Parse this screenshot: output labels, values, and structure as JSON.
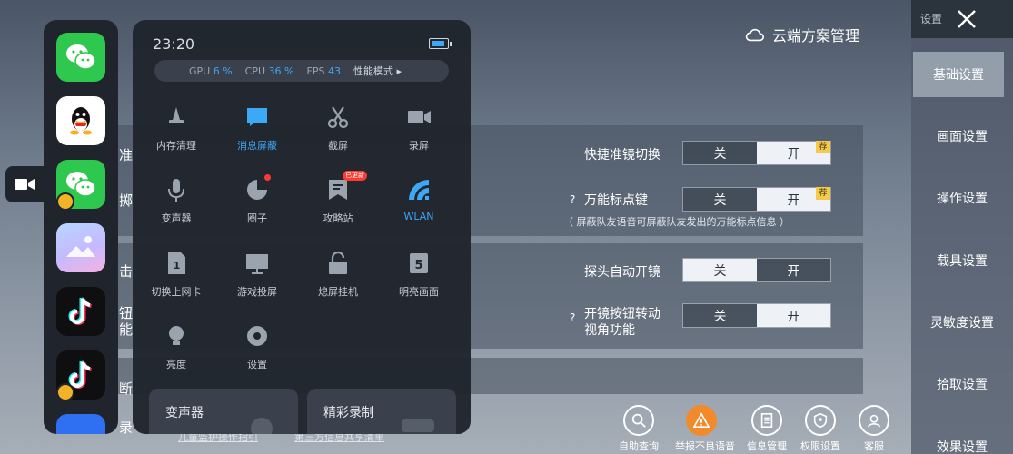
{
  "game": {
    "cloud_title": "云端方案管理",
    "rows": [
      {
        "label": "快捷准镜切换",
        "off": "关",
        "on": "开",
        "state": "on",
        "badge": "荐",
        "help": ""
      },
      {
        "label": "万能标点键",
        "off": "关",
        "on": "开",
        "state": "on",
        "badge": "荐",
        "help": "?"
      },
      {
        "label": "探头自动开镜",
        "off": "关",
        "on": "开",
        "state": "off",
        "badge": "",
        "help": ""
      },
      {
        "label": "开镜按钮转动",
        "label2": "视角功能",
        "off": "关",
        "on": "开",
        "state": "on",
        "badge": "",
        "help": "?"
      }
    ],
    "sub_note": "（ 屏蔽队友语音可屏蔽队友发出的万能标点信息 ）",
    "edge_texts": [
      "准",
      "掷",
      "击",
      "钮",
      "能",
      "断",
      "录"
    ],
    "bottom_links": [
      "儿童监护操作指引",
      "第三方信息共享清单"
    ],
    "bottom_icons": [
      {
        "label": "自助查询",
        "icon": "search-icon"
      },
      {
        "label": "举报不良语音",
        "icon": "warning-icon"
      },
      {
        "label": "信息管理",
        "icon": "document-icon"
      },
      {
        "label": "权限设置",
        "icon": "shield-icon"
      },
      {
        "label": "客服",
        "icon": "headset-icon"
      }
    ]
  },
  "settings_nav": {
    "title": "设置",
    "items": [
      "基础设置",
      "画面设置",
      "操作设置",
      "载具设置",
      "灵敏度设置",
      "拾取设置",
      "效果设置"
    ],
    "active": "基础设置"
  },
  "dock": {
    "apps": [
      {
        "name": "WeChat",
        "icon": "wechat-icon"
      },
      {
        "name": "QQ",
        "icon": "qq-icon"
      },
      {
        "name": "WeChat clone",
        "icon": "wechat-icon"
      },
      {
        "name": "Gallery",
        "icon": "gallery-icon"
      },
      {
        "name": "TikTok",
        "icon": "tiktok-icon"
      },
      {
        "name": "TikTok clone",
        "icon": "tiktok-icon"
      }
    ]
  },
  "assistant": {
    "time": "23:20",
    "perf": {
      "gpu_label": "GPU",
      "gpu": "6 %",
      "cpu_label": "CPU",
      "cpu": "36 %",
      "fps_label": "FPS",
      "fps": "43",
      "mode": "性能模式 ▸"
    },
    "tools": [
      {
        "label": "内存清理",
        "icon": "broom-icon",
        "active": false
      },
      {
        "label": "消息屏蔽",
        "icon": "message-block-icon",
        "active": true
      },
      {
        "label": "截屏",
        "icon": "scissors-icon",
        "active": false
      },
      {
        "label": "录屏",
        "icon": "video-record-icon",
        "active": false
      },
      {
        "label": "变声器",
        "icon": "microphone-icon",
        "active": false
      },
      {
        "label": "圈子",
        "icon": "circle-community-icon",
        "active": false
      },
      {
        "label": "攻略站",
        "icon": "guide-icon",
        "active": false,
        "badge": "已更新"
      },
      {
        "label": "WLAN",
        "icon": "wifi-icon",
        "active": true
      },
      {
        "label": "切换上网卡",
        "icon": "sim-card-icon",
        "active": false
      },
      {
        "label": "游戏投屏",
        "icon": "cast-icon",
        "active": false
      },
      {
        "label": "熄屏挂机",
        "icon": "lock-icon",
        "active": false
      },
      {
        "label": "明亮画面",
        "icon": "brightness-icon",
        "active": false
      },
      {
        "label": "亮度",
        "icon": "bulb-icon",
        "active": false
      },
      {
        "label": "设置",
        "icon": "gear-icon",
        "active": false
      }
    ],
    "cards": [
      "变声器",
      "精彩录制"
    ]
  }
}
